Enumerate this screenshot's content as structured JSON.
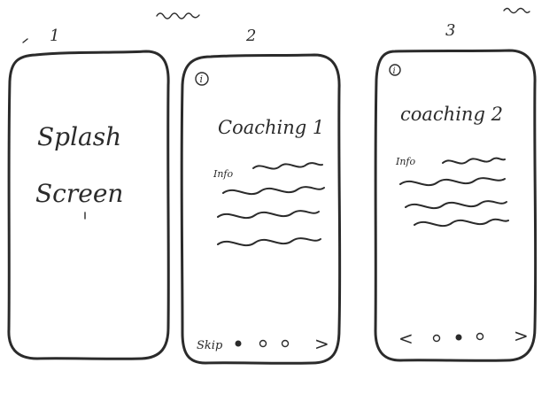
{
  "screens": [
    {
      "number": "1",
      "lines": [
        "Splash",
        "Screen"
      ]
    },
    {
      "number": "2",
      "info_icon": "i",
      "title": "Coaching 1",
      "info_label": "Info",
      "nav": {
        "skip": "Skip",
        "next": ">",
        "active_dot": 1,
        "dot_count": 3
      }
    },
    {
      "number": "3",
      "info_icon": "i",
      "title": "coaching 2",
      "info_label": "Info",
      "nav": {
        "prev": "<",
        "next": ">",
        "active_dot": 2,
        "dot_count": 3
      }
    }
  ],
  "style": {
    "ink_color": "#2b2b2b",
    "paper_color": "#ffffff"
  }
}
